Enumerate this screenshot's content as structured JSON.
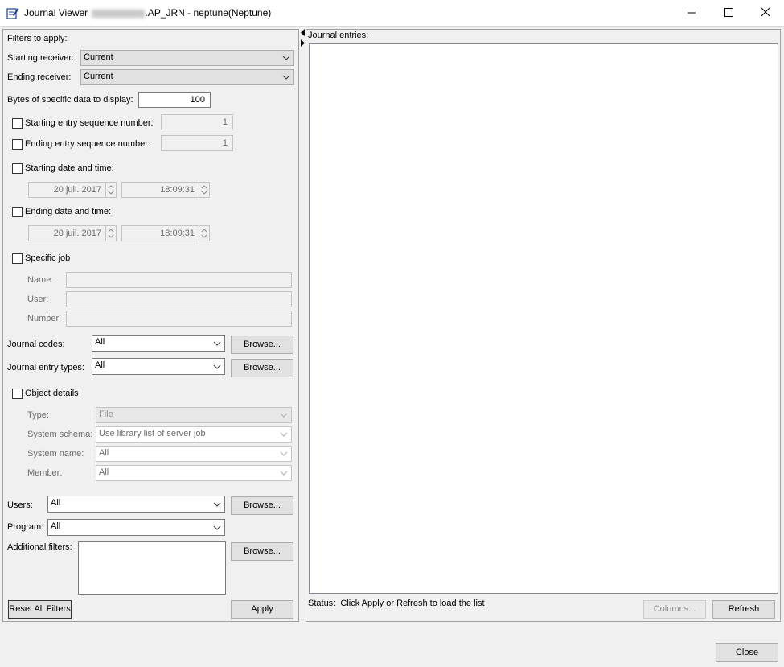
{
  "window": {
    "title_prefix": "Journal Viewer",
    "title_suffix": ".AP_JRN - neptune(Neptune)"
  },
  "filters": {
    "heading": "Filters to apply:",
    "starting_receiver": {
      "label": "Starting receiver:",
      "value": "Current"
    },
    "ending_receiver": {
      "label": "Ending receiver:",
      "value": "Current"
    },
    "bytes_label": "Bytes of specific data to display:",
    "bytes_value": "100",
    "start_seq": {
      "label": "Starting entry sequence number:",
      "value": "1"
    },
    "end_seq": {
      "label": "Ending entry sequence number:",
      "value": "1"
    },
    "start_date": {
      "label": "Starting date and time:",
      "date": "20 juil. 2017",
      "time": "18:09:31"
    },
    "end_date": {
      "label": "Ending date and time:",
      "date": "20 juil. 2017",
      "time": "18:09:31"
    },
    "specific_job": {
      "label": "Specific job",
      "name_label": "Name:",
      "user_label": "User:",
      "number_label": "Number:"
    },
    "journal_codes": {
      "label": "Journal codes:",
      "value": "All",
      "browse": "Browse..."
    },
    "entry_types": {
      "label": "Journal entry types:",
      "value": "All",
      "browse": "Browse..."
    },
    "object_details": {
      "label": "Object details",
      "type_label": "Type:",
      "type_value": "File",
      "schema_label": "System schema:",
      "schema_value": "Use library list of server job",
      "sysname_label": "System name:",
      "sysname_value": "All",
      "member_label": "Member:",
      "member_value": "All"
    },
    "users": {
      "label": "Users:",
      "value": "All",
      "browse": "Browse..."
    },
    "program": {
      "label": "Program:",
      "value": "All"
    },
    "additional": {
      "label": "Additional filters:",
      "browse": "Browse..."
    },
    "reset_button": "Reset All Filters",
    "apply_button": "Apply"
  },
  "entries": {
    "label": "Journal entries:",
    "status_label": "Status:",
    "status_text": "Click Apply or Refresh to load the list",
    "columns_button": "Columns...",
    "refresh_button": "Refresh"
  },
  "footer": {
    "close_button": "Close"
  },
  "colors": {
    "accent": "#0078d7"
  }
}
